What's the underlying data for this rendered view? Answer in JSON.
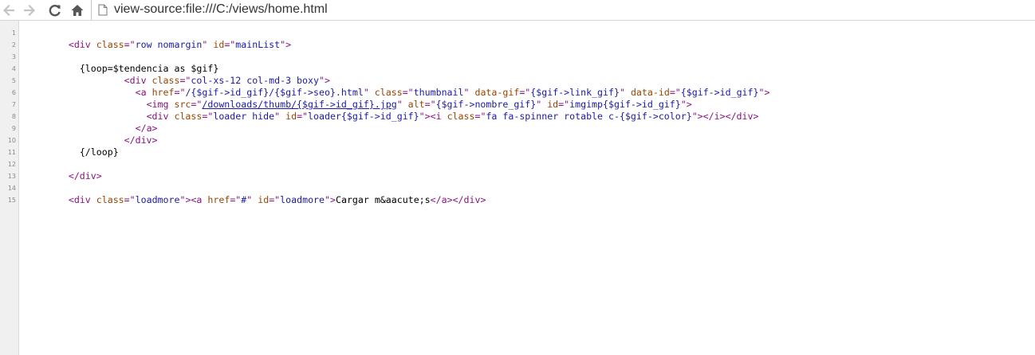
{
  "browser": {
    "url": "view-source:file:///C:/views/home.html",
    "icons": {
      "back": "back-arrow-icon",
      "forward": "forward-arrow-icon",
      "reload": "reload-icon",
      "home": "home-icon",
      "page": "page-icon"
    }
  },
  "source": {
    "lines": [
      {
        "num": "1",
        "indent": "",
        "tokens": []
      },
      {
        "num": "2",
        "indent": "        ",
        "tokens": [
          {
            "t": "tag",
            "s": "<div "
          },
          {
            "t": "attr",
            "s": "class"
          },
          {
            "t": "tag",
            "s": "=\""
          },
          {
            "t": "val",
            "s": "row nomargin"
          },
          {
            "t": "tag",
            "s": "\" "
          },
          {
            "t": "attr",
            "s": "id"
          },
          {
            "t": "tag",
            "s": "=\""
          },
          {
            "t": "val",
            "s": "mainList"
          },
          {
            "t": "tag",
            "s": "\">"
          }
        ]
      },
      {
        "num": "3",
        "indent": "",
        "tokens": []
      },
      {
        "num": "4",
        "indent": "          ",
        "tokens": [
          {
            "t": "txt",
            "s": "{loop=$tendencia as $gif}"
          }
        ]
      },
      {
        "num": "5",
        "indent": "                  ",
        "tokens": [
          {
            "t": "tag",
            "s": "<div "
          },
          {
            "t": "attr",
            "s": "class"
          },
          {
            "t": "tag",
            "s": "=\""
          },
          {
            "t": "val",
            "s": "col-xs-12 col-md-3 boxy"
          },
          {
            "t": "tag",
            "s": "\">"
          }
        ]
      },
      {
        "num": "6",
        "indent": "                    ",
        "tokens": [
          {
            "t": "tag",
            "s": "<a "
          },
          {
            "t": "attr",
            "s": "href"
          },
          {
            "t": "tag",
            "s": "=\""
          },
          {
            "t": "val",
            "s": "/{$gif->id_gif}/{$gif->seo}.html"
          },
          {
            "t": "tag",
            "s": "\" "
          },
          {
            "t": "attr",
            "s": "class"
          },
          {
            "t": "tag",
            "s": "=\""
          },
          {
            "t": "val",
            "s": "thumbnail"
          },
          {
            "t": "tag",
            "s": "\" "
          },
          {
            "t": "attr",
            "s": "data-gif"
          },
          {
            "t": "tag",
            "s": "=\""
          },
          {
            "t": "val",
            "s": "{$gif->link_gif}"
          },
          {
            "t": "tag",
            "s": "\" "
          },
          {
            "t": "attr",
            "s": "data-id"
          },
          {
            "t": "tag",
            "s": "=\""
          },
          {
            "t": "val",
            "s": "{$gif->id_gif}"
          },
          {
            "t": "tag",
            "s": "\">"
          }
        ]
      },
      {
        "num": "7",
        "indent": "                      ",
        "tokens": [
          {
            "t": "tag",
            "s": "<img "
          },
          {
            "t": "attr",
            "s": "src"
          },
          {
            "t": "tag",
            "s": "=\""
          },
          {
            "t": "link",
            "s": "/downloads/thumb/{$gif->id_gif}.jpg"
          },
          {
            "t": "tag",
            "s": "\" "
          },
          {
            "t": "attr",
            "s": "alt"
          },
          {
            "t": "tag",
            "s": "=\""
          },
          {
            "t": "val",
            "s": "{$gif->nombre_gif}"
          },
          {
            "t": "tag",
            "s": "\" "
          },
          {
            "t": "attr",
            "s": "id"
          },
          {
            "t": "tag",
            "s": "=\""
          },
          {
            "t": "val",
            "s": "imgimp{$gif->id_gif}"
          },
          {
            "t": "tag",
            "s": "\">"
          }
        ]
      },
      {
        "num": "8",
        "indent": "                      ",
        "tokens": [
          {
            "t": "tag",
            "s": "<div "
          },
          {
            "t": "attr",
            "s": "class"
          },
          {
            "t": "tag",
            "s": "=\""
          },
          {
            "t": "val",
            "s": "loader hide"
          },
          {
            "t": "tag",
            "s": "\" "
          },
          {
            "t": "attr",
            "s": "id"
          },
          {
            "t": "tag",
            "s": "=\""
          },
          {
            "t": "val",
            "s": "loader{$gif->id_gif}"
          },
          {
            "t": "tag",
            "s": "\">"
          },
          {
            "t": "tag",
            "s": "<i "
          },
          {
            "t": "attr",
            "s": "class"
          },
          {
            "t": "tag",
            "s": "=\""
          },
          {
            "t": "val",
            "s": "fa fa-spinner rotable c-{$gif->color}"
          },
          {
            "t": "tag",
            "s": "\">"
          },
          {
            "t": "tag",
            "s": "</i>"
          },
          {
            "t": "tag",
            "s": "</div>"
          }
        ]
      },
      {
        "num": "9",
        "indent": "                    ",
        "tokens": [
          {
            "t": "tag",
            "s": "</a>"
          }
        ]
      },
      {
        "num": "10",
        "indent": "                  ",
        "tokens": [
          {
            "t": "tag",
            "s": "</div>"
          }
        ]
      },
      {
        "num": "11",
        "indent": "          ",
        "tokens": [
          {
            "t": "txt",
            "s": "{/loop}"
          }
        ]
      },
      {
        "num": "12",
        "indent": "",
        "tokens": []
      },
      {
        "num": "13",
        "indent": "        ",
        "tokens": [
          {
            "t": "tag",
            "s": "</div>"
          }
        ]
      },
      {
        "num": "14",
        "indent": "",
        "tokens": []
      },
      {
        "num": "15",
        "indent": "        ",
        "tokens": [
          {
            "t": "tag",
            "s": "<div "
          },
          {
            "t": "attr",
            "s": "class"
          },
          {
            "t": "tag",
            "s": "=\""
          },
          {
            "t": "val",
            "s": "loadmore"
          },
          {
            "t": "tag",
            "s": "\">"
          },
          {
            "t": "tag",
            "s": "<a "
          },
          {
            "t": "attr",
            "s": "href"
          },
          {
            "t": "tag",
            "s": "=\""
          },
          {
            "t": "val",
            "s": "#"
          },
          {
            "t": "tag",
            "s": "\" "
          },
          {
            "t": "attr",
            "s": "id"
          },
          {
            "t": "tag",
            "s": "=\""
          },
          {
            "t": "val",
            "s": "loadmore"
          },
          {
            "t": "tag",
            "s": "\">"
          },
          {
            "t": "txt",
            "s": "Cargar m&aacute;s"
          },
          {
            "t": "tag",
            "s": "</a>"
          },
          {
            "t": "tag",
            "s": "</div>"
          }
        ]
      }
    ]
  },
  "colors": {
    "tag": "#881280",
    "attribute": "#994500",
    "value": "#1a1aa6",
    "gutter_bg": "#f0f0f0",
    "line_number": "#8a8a8a"
  }
}
